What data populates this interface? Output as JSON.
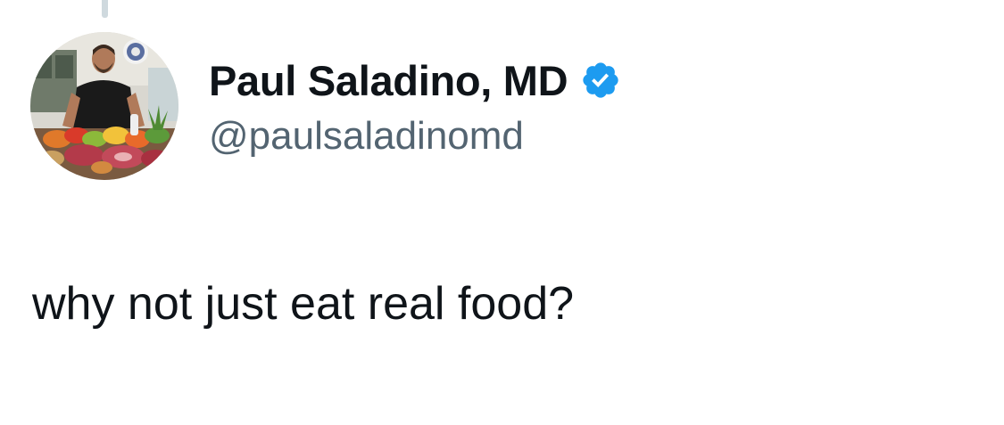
{
  "tweet": {
    "author": {
      "display_name": "Paul Saladino, MD",
      "handle": "@paulsaladinomd",
      "verified": true,
      "verified_badge_color": "#1d9bf0",
      "avatar_icon": "profile-photo"
    },
    "text": "why not just eat real food?",
    "colors": {
      "text": "#0f1419",
      "secondary_text": "#536471",
      "thread_line": "#cfd9de"
    }
  }
}
